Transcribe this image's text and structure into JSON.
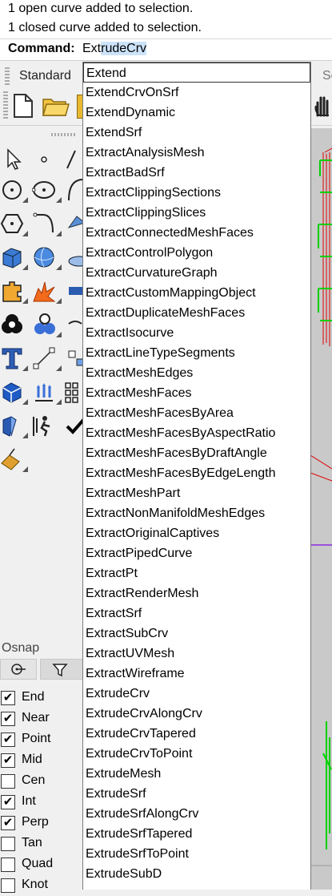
{
  "history": {
    "line1": "1 open curve added to selection.",
    "line2": "1 closed curve added to selection."
  },
  "command": {
    "label": "Command:",
    "typed": "Ext",
    "autocomplete": "rudeCrv"
  },
  "tabs": {
    "standard": "Standard",
    "right_partial": "Se"
  },
  "dropdown_items": [
    "Extend",
    "ExtendCrvOnSrf",
    "ExtendDynamic",
    "ExtendSrf",
    "ExtractAnalysisMesh",
    "ExtractBadSrf",
    "ExtractClippingSections",
    "ExtractClippingSlices",
    "ExtractConnectedMeshFaces",
    "ExtractControlPolygon",
    "ExtractCurvatureGraph",
    "ExtractCustomMappingObject",
    "ExtractDuplicateMeshFaces",
    "ExtractIsocurve",
    "ExtractLineTypeSegments",
    "ExtractMeshEdges",
    "ExtractMeshFaces",
    "ExtractMeshFacesByArea",
    "ExtractMeshFacesByAspectRatio",
    "ExtractMeshFacesByDraftAngle",
    "ExtractMeshFacesByEdgeLength",
    "ExtractMeshPart",
    "ExtractNonManifoldMeshEdges",
    "ExtractOriginalCaptives",
    "ExtractPipedCurve",
    "ExtractPt",
    "ExtractRenderMesh",
    "ExtractSrf",
    "ExtractSubCrv",
    "ExtractUVMesh",
    "ExtractWireframe",
    "ExtrudeCrv",
    "ExtrudeCrvAlongCrv",
    "ExtrudeCrvTapered",
    "ExtrudeCrvToPoint",
    "ExtrudeMesh",
    "ExtrudeSrf",
    "ExtrudeSrfAlongCrv",
    "ExtrudeSrfTapered",
    "ExtrudeSrfToPoint",
    "ExtrudeSubD"
  ],
  "osnap": {
    "title": "Osnap",
    "items": [
      {
        "label": "End",
        "checked": true
      },
      {
        "label": "Near",
        "checked": true
      },
      {
        "label": "Point",
        "checked": true
      },
      {
        "label": "Mid",
        "checked": true
      },
      {
        "label": "Cen",
        "checked": false
      },
      {
        "label": "Int",
        "checked": true
      },
      {
        "label": "Perp",
        "checked": true
      },
      {
        "label": "Tan",
        "checked": false
      },
      {
        "label": "Quad",
        "checked": false
      },
      {
        "label": "Knot",
        "checked": false
      }
    ]
  },
  "colors": {
    "autocomplete_highlight": "#cce3f9",
    "viewport_curve_green": "#00d000",
    "viewport_axis_red": "#e00000"
  }
}
